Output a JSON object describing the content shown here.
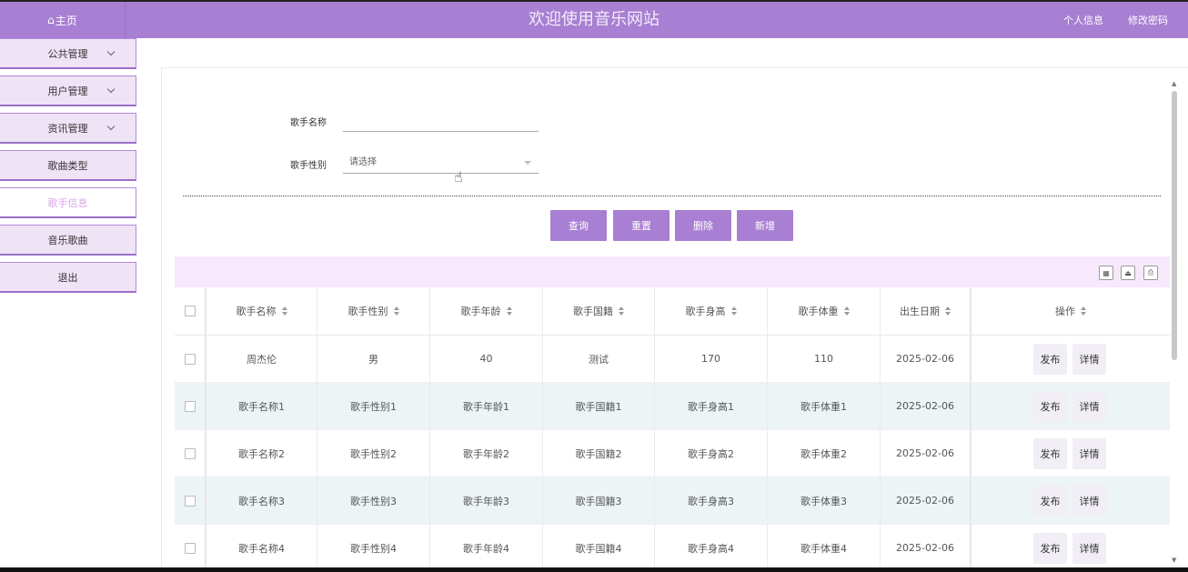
{
  "header": {
    "home_icon": "home-icon",
    "home_label": "主页",
    "title": "欢迎使用音乐网站",
    "links": [
      "个人信息",
      "修改密码"
    ]
  },
  "sidebar": {
    "items": [
      {
        "label": "公共管理",
        "has_submenu": true
      },
      {
        "label": "用户管理",
        "has_submenu": true
      },
      {
        "label": "资讯管理",
        "has_submenu": true
      },
      {
        "label": "歌曲类型",
        "has_submenu": false
      },
      {
        "label": "歌手信息",
        "has_submenu": false,
        "active": true
      },
      {
        "label": "音乐歌曲",
        "has_submenu": false
      },
      {
        "label": "退出",
        "has_submenu": false
      }
    ]
  },
  "search": {
    "name_label": "歌手名称",
    "name_value": "",
    "gender_label": "歌手性别",
    "gender_placeholder": "请选择"
  },
  "actions": [
    "查询",
    "重置",
    "删除",
    "新增"
  ],
  "table": {
    "tool_icons": [
      "columns-icon",
      "export-icon",
      "print-icon"
    ],
    "headers": [
      "歌手名称",
      "歌手性别",
      "歌手年龄",
      "歌手国籍",
      "歌手身高",
      "歌手体重",
      "出生日期",
      "操作"
    ],
    "rows": [
      [
        "周杰伦",
        "男",
        "40",
        "测试",
        "170",
        "110",
        "2025-02-06"
      ],
      [
        "歌手名称1",
        "歌手性别1",
        "歌手年龄1",
        "歌手国籍1",
        "歌手身高1",
        "歌手体重1",
        "2025-02-06"
      ],
      [
        "歌手名称2",
        "歌手性别2",
        "歌手年龄2",
        "歌手国籍2",
        "歌手身高2",
        "歌手体重2",
        "2025-02-06"
      ],
      [
        "歌手名称3",
        "歌手性别3",
        "歌手年龄3",
        "歌手国籍3",
        "歌手身高3",
        "歌手体重3",
        "2025-02-06"
      ],
      [
        "歌手名称4",
        "歌手性别4",
        "歌手年龄4",
        "歌手国籍4",
        "歌手身高4",
        "歌手体重4",
        "2025-02-06"
      ]
    ],
    "row_actions": [
      "发布",
      "详情"
    ]
  },
  "colors": {
    "accent": "#a87fd2",
    "sidebar_bg": "#efe3f6",
    "toolbar_bg": "#f7e8fb",
    "stripe": "#ecf4f6",
    "active_text": "#d7a6e4"
  }
}
